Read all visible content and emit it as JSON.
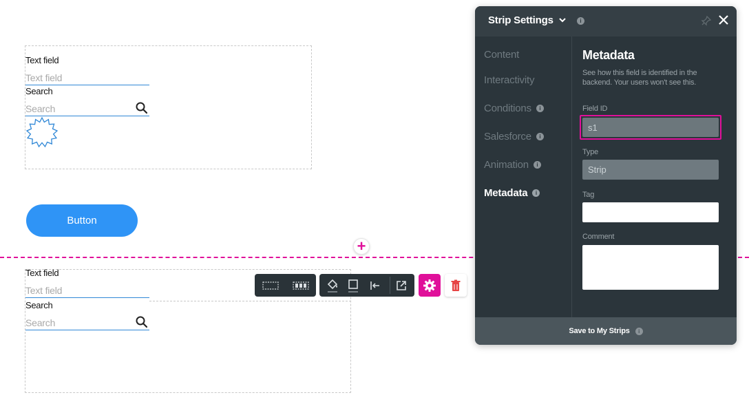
{
  "canvas": {
    "strip1": {
      "text_field_label": "Text field",
      "text_field_placeholder": "Text field",
      "search_label": "Search",
      "search_placeholder": "Search"
    },
    "button_label": "Button",
    "strip2": {
      "text_field_label": "Text field",
      "text_field_placeholder": "Text field",
      "search_label": "Search",
      "search_placeholder": "Search"
    },
    "add_symbol": "+"
  },
  "panel": {
    "title": "Strip Settings",
    "nav": [
      {
        "label": "Content",
        "info": false
      },
      {
        "label": "Interactivity",
        "info": false
      },
      {
        "label": "Conditions",
        "info": true
      },
      {
        "label": "Salesforce",
        "info": true
      },
      {
        "label": "Animation",
        "info": true
      },
      {
        "label": "Metadata",
        "info": true,
        "active": true
      }
    ],
    "metadata": {
      "heading": "Metadata",
      "description": "See how this field is identified in the backend. Your users won't see this.",
      "field_id_label": "Field ID",
      "field_id_value": "s1",
      "type_label": "Type",
      "type_value": "Strip",
      "tag_label": "Tag",
      "tag_value": "",
      "comment_label": "Comment",
      "comment_value": ""
    },
    "footer_label": "Save to My Strips"
  },
  "colors": {
    "accent": "#e0109a",
    "button": "#2f94f6",
    "panel_bg": "#2b353b",
    "input_underline": "#2f87d6"
  },
  "icons": [
    "search-icon",
    "badge-icon",
    "chevron-down-icon",
    "info-icon",
    "pin-icon",
    "close-icon",
    "paint-bucket-icon",
    "border-icon",
    "align-left-icon",
    "external-link-icon",
    "gear-icon",
    "trash-icon"
  ]
}
